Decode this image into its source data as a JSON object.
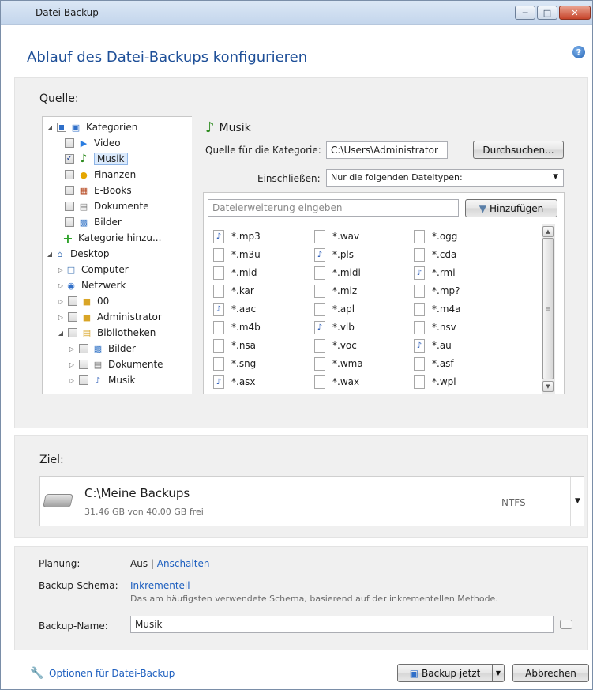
{
  "window": {
    "title": "Datei-Backup"
  },
  "header": {
    "title": "Ablauf des Datei-Backups konfigurieren"
  },
  "source": {
    "label": "Quelle:",
    "tree": [
      {
        "label": "Kategorien",
        "icon": "categories-icon"
      },
      {
        "label": "Video",
        "icon": "video-icon"
      },
      {
        "label": "Musik",
        "icon": "music-icon",
        "checked": true,
        "selected": true
      },
      {
        "label": "Finanzen",
        "icon": "finance-icon"
      },
      {
        "label": "E-Books",
        "icon": "ebook-icon"
      },
      {
        "label": "Dokumente",
        "icon": "document-icon"
      },
      {
        "label": "Bilder",
        "icon": "pictures-icon"
      },
      {
        "label": "Kategorie hinzu...",
        "icon": "add-category-icon"
      },
      {
        "label": "Desktop",
        "icon": "desktop-icon"
      },
      {
        "label": "Computer",
        "icon": "computer-icon"
      },
      {
        "label": "Netzwerk",
        "icon": "network-icon"
      },
      {
        "label": "00",
        "icon": "user-folder-icon"
      },
      {
        "label": "Administrator",
        "icon": "user-folder-icon"
      },
      {
        "label": "Bibliotheken",
        "icon": "libraries-icon"
      },
      {
        "label": "Bilder",
        "icon": "pictures-library-icon"
      },
      {
        "label": "Dokumente",
        "icon": "documents-library-icon"
      },
      {
        "label": "Musik",
        "icon": "music-library-icon"
      }
    ],
    "category": {
      "title": "Musik",
      "source_label": "Quelle für die Kategorie:",
      "source_value": "C:\\Users\\Administrator",
      "browse_button": "Durchsuchen...",
      "include_label": "Einschließen:",
      "include_value": "Nur die folgenden Dateitypen:",
      "ext_placeholder": "Dateierweiterung eingeben",
      "add_button": "Hinzufügen",
      "file_types": [
        "*.mp3",
        "*.wav",
        "*.ogg",
        "*.m3u",
        "*.pls",
        "*.cda",
        "*.mid",
        "*.midi",
        "*.rmi",
        "*.kar",
        "*.miz",
        "*.mp?",
        "*.aac",
        "*.apl",
        "*.m4a",
        "*.m4b",
        "*.vlb",
        "*.nsv",
        "*.nsa",
        "*.voc",
        "*.au",
        "*.sng",
        "*.wma",
        "*.asf",
        "*.asx",
        "*.wax",
        "*.wpl"
      ]
    }
  },
  "target": {
    "label": "Ziel:",
    "path": "C:\\Meine Backups",
    "space": "31,46 GB von 40,00 GB frei",
    "fs": "NTFS"
  },
  "settings": {
    "planning_label": "Planung:",
    "planning_off": "Aus",
    "planning_sep": "|",
    "planning_on": "Anschalten",
    "scheme_label": "Backup-Schema:",
    "scheme_value": "Inkrementell",
    "scheme_desc": "Das am häufigsten verwendete Schema, basierend auf der inkrementellen Methode.",
    "name_label": "Backup-Name:",
    "name_value": "Musik"
  },
  "footer": {
    "options_link": "Optionen für Datei-Backup",
    "backup_now": "Backup jetzt",
    "cancel": "Abbrechen"
  }
}
